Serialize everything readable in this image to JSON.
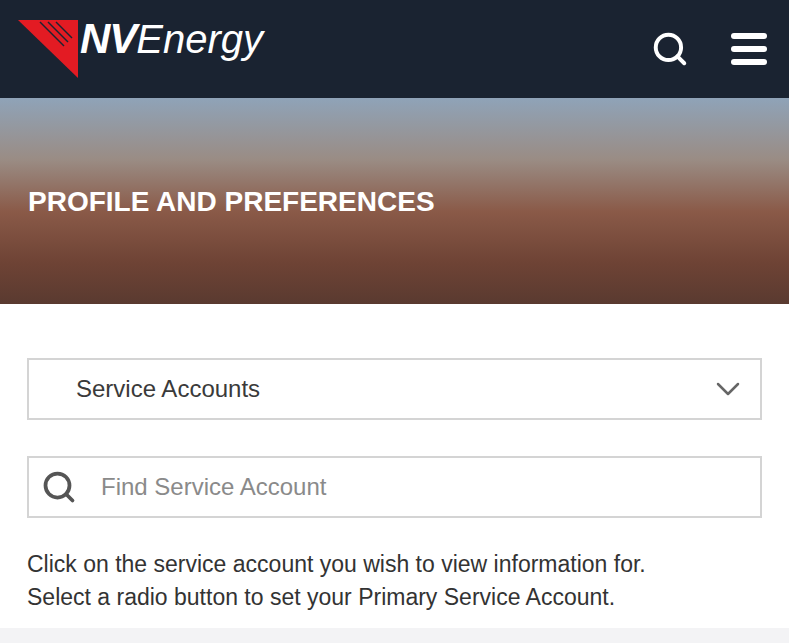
{
  "header": {
    "logo": {
      "bold": "NV",
      "rest": "Energy"
    }
  },
  "hero": {
    "title": "PROFILE AND PREFERENCES"
  },
  "dropdown": {
    "label": "Service Accounts",
    "expanded": false
  },
  "search": {
    "placeholder": "Find Service Account"
  },
  "instructions": [
    "Click on the service account you wish to view information for.",
    "Select a radio button to set your Primary Service Account."
  ]
}
